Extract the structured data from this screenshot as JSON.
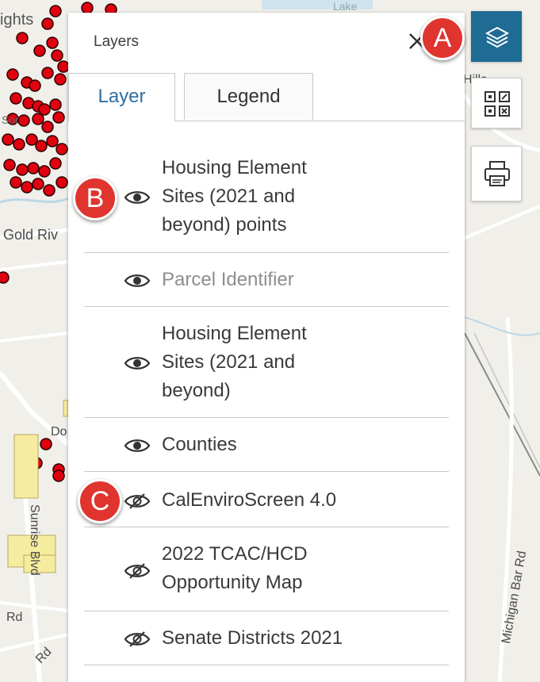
{
  "map": {
    "labels": {
      "heights": "ights",
      "lake": "Lake",
      "hills": "Hills",
      "gold_river": "Gold Riv",
      "sor": "Sor",
      "do": "Do",
      "sunrise_blvd": "Sunrise Blvd",
      "rd": "Rd",
      "rd2": "Rd",
      "michigan_bar_rd": "Michigan Bar Rd"
    },
    "point_color": "#e0000f",
    "parcel_color": "#f6ec9f"
  },
  "panel": {
    "title": "Layers",
    "close_icon": "close-icon",
    "tabs": [
      {
        "label": "Layer",
        "active": true
      },
      {
        "label": "Legend",
        "active": false
      }
    ],
    "layers": [
      {
        "lines": [
          "Housing Element",
          "Sites (2021 and",
          "beyond) points"
        ],
        "visible": true,
        "icon": "eye-icon"
      },
      {
        "lines": [
          "Parcel Identifier"
        ],
        "visible": true,
        "dimmed": true,
        "icon": "eye-icon"
      },
      {
        "lines": [
          "Housing Element",
          "Sites (2021 and",
          "beyond)"
        ],
        "visible": true,
        "icon": "eye-icon"
      },
      {
        "lines": [
          "Counties"
        ],
        "visible": true,
        "icon": "eye-icon"
      },
      {
        "lines": [
          "CalEnviroScreen 4.0"
        ],
        "visible": false,
        "icon": "eye-off-icon"
      },
      {
        "lines": [
          "2022 TCAC/HCD",
          "Opportunity Map"
        ],
        "visible": false,
        "icon": "eye-off-icon"
      },
      {
        "lines": [
          "Senate Districts 2021"
        ],
        "visible": false,
        "icon": "eye-off-icon"
      }
    ]
  },
  "toolbar": [
    {
      "icon": "layers-icon",
      "active": true
    },
    {
      "icon": "qr-code-icon",
      "active": false
    },
    {
      "icon": "print-icon",
      "active": false
    }
  ],
  "callouts": [
    "A",
    "B",
    "C"
  ],
  "colors": {
    "accent": "#1e6b93",
    "tab_active_text": "#2f6f9f",
    "callout": "#e0342f"
  }
}
